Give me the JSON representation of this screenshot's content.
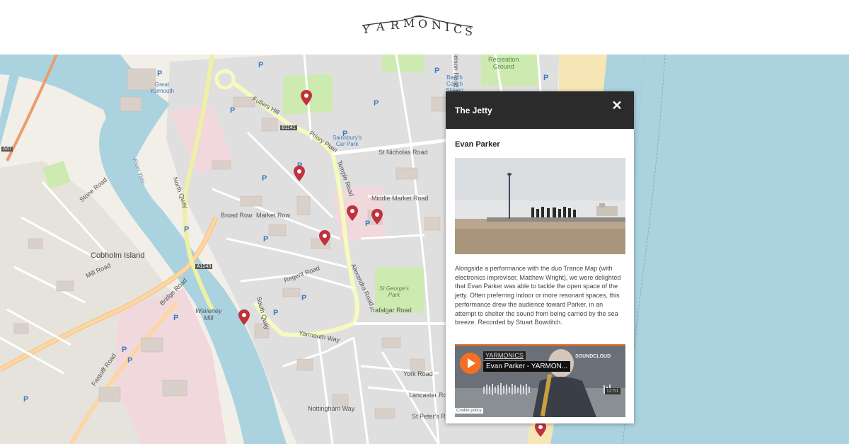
{
  "header": {
    "logo_text": "YARMONICS",
    "logo_letters": [
      "Y",
      "A",
      "R",
      "M",
      "O",
      "N",
      "I",
      "C",
      "S"
    ]
  },
  "map": {
    "labels": {
      "cobholm": "Cobholm Island",
      "great_yarmouth": "Great\nYarmouth",
      "recreation": "Recreation\nGround",
      "fullers_hill": "Fullers Hill",
      "priory_plain": "Priory Plain",
      "temple_road": "Temple Road",
      "north_quay": "North Quay",
      "stone_road": "Stone Road",
      "mill_road": "Mill Road",
      "bridge_road": "Bridge Road",
      "south_quay": "South Quay",
      "yarmouth_way": "Yarmouth Way",
      "market_row": "Market Row",
      "broad_row": "Broad Row",
      "regent_road": "Regent Road",
      "alexandra_road": "Alexandra Road",
      "st_georges_park": "St George's\nPark",
      "trafalgar_road": "Trafalgar Road",
      "nottingham_way": "Nottingham Way",
      "lancaster_road": "Lancaster Road",
      "york_road": "York Road",
      "st_peters_road": "St Peter's Road",
      "nelson_road": "Nelson Road North",
      "sainsburys": "Sainsbury's\nCar Park",
      "beach_coach": "Beach\nCoach\nStation",
      "middle_market": "Middle Market Road",
      "st_nicholas": "St Nicholas Road",
      "waveney_mill": "Waveney\nMill",
      "river_yare": "River Yare",
      "a47": "A47",
      "a1243": "A1243",
      "b1141": "B1141",
      "fastolff": "Fastolff Road"
    }
  },
  "colors": {
    "sea": "#aad3df",
    "land": "#f2efe9",
    "dense": "#e0dfdf",
    "park": "#cdebb0",
    "marker": "#c0313b",
    "major_road": "#fcd6a4",
    "yellow_road": "#f7fabf",
    "popup_header": "#2b2b2b",
    "accent": "#f26f23"
  },
  "popup": {
    "title": "The Jetty",
    "close_label": "✕",
    "artist": "Evan Parker",
    "description": "Alongside a performance with the duo Trance Map (with electronics improviser, Matthew Wright), we were delighted that Evan Parker was able to tackle the open space of the jetty. Often preferring indoor or more resonant spaces, this performance drew the audience toward Parker, in an attempt to shelter the sound from being carried by the sea breeze. Recorded by Stuart Bowditch.",
    "player": {
      "user": "YARMONICS",
      "track": "Evan Parker - YARMON...",
      "brand": "SOUNDCLOUD",
      "duration": "12:51",
      "cookie": "Cookie policy",
      "play_icon": "play-icon"
    }
  }
}
